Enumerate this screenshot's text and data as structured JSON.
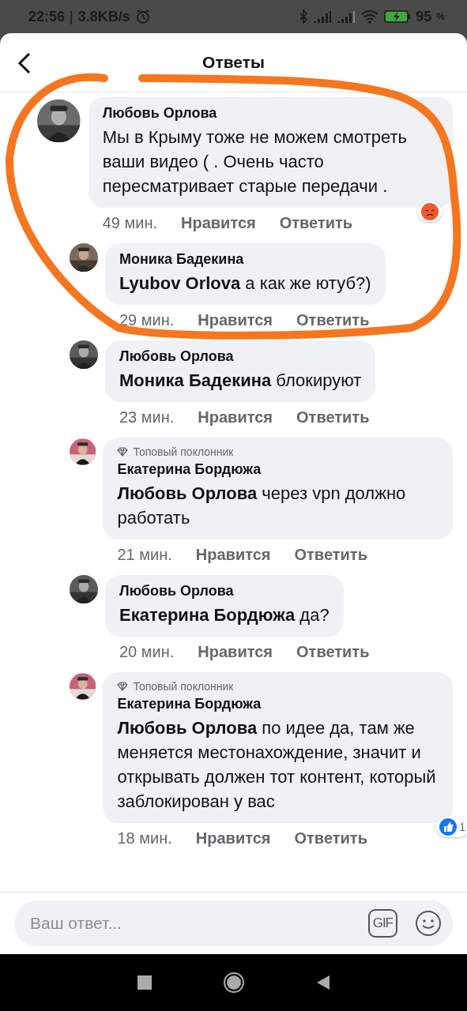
{
  "status_bar": {
    "time": "22:56",
    "separator": "|",
    "speed": "3.8KB/s",
    "battery": "95",
    "battery_unit": "%"
  },
  "header": {
    "title": "Ответы"
  },
  "comments": [
    {
      "kind": "comment",
      "author": "Любовь Орлова",
      "text": "Мы в Крыму тоже не можем смотреть ваши видео ( . Очень часто пересматривает старые передачи .",
      "time": "49 мин.",
      "like": "Нравится",
      "reply": "Ответить",
      "reaction": {
        "kind": "angry"
      }
    },
    {
      "kind": "reply",
      "author": "Моника Бадекина",
      "text": "**Lyubov Orlova** а как же ютуб?)",
      "time": "29 мин.",
      "like": "Нравится",
      "reply": "Ответить"
    },
    {
      "kind": "reply",
      "author": "Любовь Орлова",
      "text": "**Моника Бадекина** блокируют",
      "time": "23 мин.",
      "like": "Нравится",
      "reply": "Ответить"
    },
    {
      "kind": "reply",
      "badge": "Топовый поклонник",
      "author": "Екатерина Бордюжа",
      "text": "**Любовь Орлова** через vpn должно работать",
      "time": "21 мин.",
      "like": "Нравится",
      "reply": "Ответить"
    },
    {
      "kind": "reply",
      "author": "Любовь Орлова",
      "text": "**Екатерина Бордюжа** да?",
      "time": "20 мин.",
      "like": "Нравится",
      "reply": "Ответить"
    },
    {
      "kind": "reply",
      "badge": "Топовый поклонник",
      "author": "Екатерина Бордюжа",
      "text": "**Любовь Орлова** по идее да, там же меняется местонахождение, значит и открывать должен тот контент, который заблокирован у вас",
      "time": "18 мин.",
      "like": "Нравится",
      "reply": "Ответить",
      "reaction": {
        "kind": "like",
        "count": "1"
      }
    }
  ],
  "composer": {
    "placeholder": "Ваш ответ...",
    "gif": "GIF"
  }
}
